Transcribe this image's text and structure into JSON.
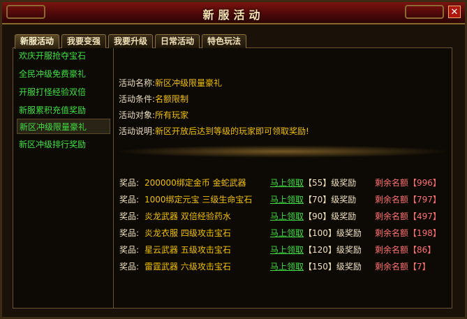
{
  "window": {
    "title": "新服活动",
    "close_glyph": "✕"
  },
  "tabs": [
    "新服活动",
    "我要变强",
    "我要升级",
    "日常活动",
    "特色玩法"
  ],
  "left_list": [
    "欢庆开服抢夺宝石",
    "全民冲级免费豪礼",
    "开服打怪经验双倍",
    "新服累积充值奖励",
    "新区冲级限量豪礼",
    "新区冲级排行奖励"
  ],
  "selected_index": 4,
  "detail": {
    "name_label": "活动名称:",
    "name_value": "新区冲级限量豪礼",
    "cond_label": "活动条件:",
    "cond_value": "名额限制",
    "target_label": "活动对象:",
    "target_value": "所有玩家",
    "desc_label": "活动说明:",
    "desc_value": "新区开放后达到等级的玩家即可领取奖励!"
  },
  "rewards": [
    {
      "label": "奖品:",
      "items": "200000绑定金币   金蛇武器",
      "claim": "马上领取",
      "level": "【55】级奖励",
      "remain": "剩余名额",
      "count": "【996】"
    },
    {
      "label": "奖品:",
      "items": "1000绑定元宝 三级生命宝石",
      "claim": "马上领取",
      "level": "【70】级奖励",
      "remain": "剩余名额",
      "count": "【797】"
    },
    {
      "label": "奖品:",
      "items": "炎龙武器   双倍经验药水",
      "claim": "马上领取",
      "level": "【90】级奖励",
      "remain": "剩余名额",
      "count": "【497】"
    },
    {
      "label": "奖品:",
      "items": "炎龙衣服   四级攻击宝石",
      "claim": "马上领取",
      "level": "【100】级奖励",
      "remain": "剩余名额",
      "count": "【198】"
    },
    {
      "label": "奖品:",
      "items": "星云武器   五级攻击宝石",
      "claim": "马上领取",
      "level": "【120】级奖励",
      "remain": "剩余名额",
      "count": "【86】"
    },
    {
      "label": "奖品:",
      "items": "雷霆武器   六级攻击宝石",
      "claim": "马上领取",
      "level": "【150】级奖励",
      "remain": "剩余名额",
      "count": "【7】"
    }
  ],
  "colors": {
    "green": "#3ee040",
    "gold": "#f0c000",
    "red": "#ff7070"
  }
}
